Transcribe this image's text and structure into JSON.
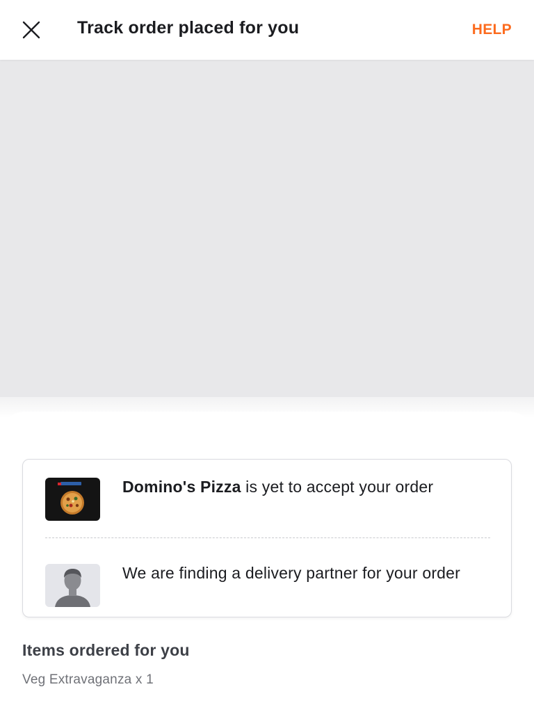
{
  "header": {
    "close_icon": "close-icon",
    "title": "Track order placed for you",
    "help_label": "HELP",
    "accent_color": "#fc6b1e"
  },
  "map": {
    "background_color": "#e8e8ea"
  },
  "status_card": {
    "restaurant": {
      "name": "Domino's Pizza",
      "status_text": " is yet to accept your order",
      "logo_icon": "dominos-pizza-thumbnail"
    },
    "delivery": {
      "status_text": "We are finding a delivery partner for your order",
      "avatar_icon": "delivery-partner-avatar-icon"
    }
  },
  "items_section": {
    "title": "Items ordered for you",
    "items": [
      {
        "name": "Veg Extravaganza x 1"
      }
    ]
  }
}
